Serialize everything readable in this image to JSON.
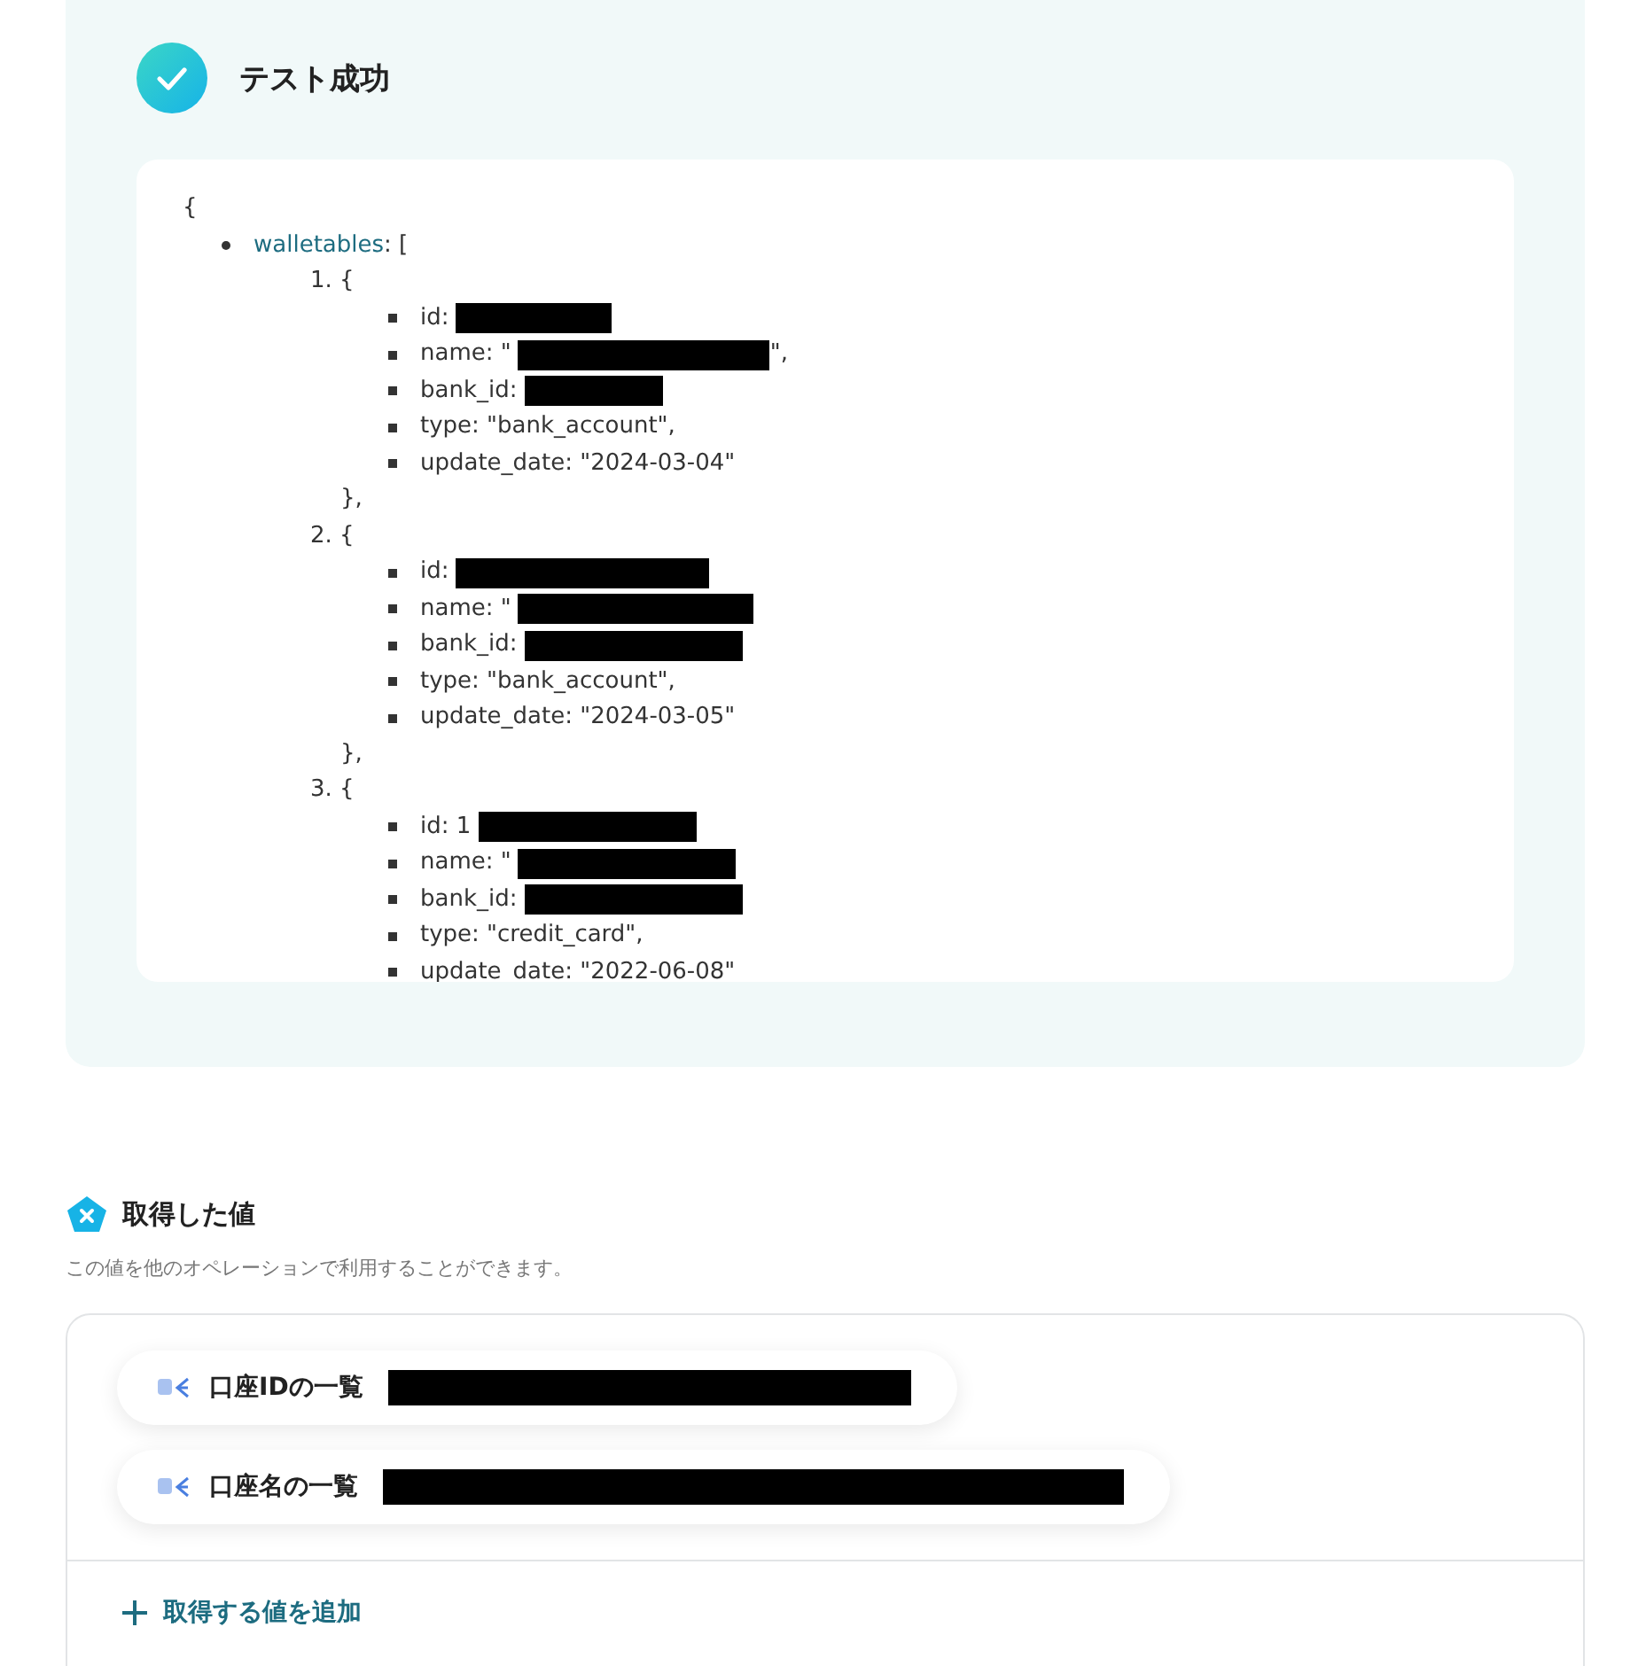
{
  "result": {
    "title": "テスト成功"
  },
  "output": {
    "open": "{",
    "key": "walletables",
    "key_suffix": ": [",
    "entries": [
      {
        "marker": "1. {",
        "close": "},",
        "fields": [
          {
            "text": "id:",
            "redacted": true
          },
          {
            "text": "name: \"",
            "redacted": true,
            "after": "\","
          },
          {
            "text": "bank_id:",
            "redacted": true
          },
          {
            "text": "type: \"bank_account\","
          },
          {
            "text": "update_date: \"2024-03-04\""
          }
        ]
      },
      {
        "marker": "2. {",
        "close": "},",
        "fields": [
          {
            "text": "id:",
            "redacted": true
          },
          {
            "text": "name: \"",
            "redacted": true
          },
          {
            "text": "bank_id:",
            "redacted": true
          },
          {
            "text": "type: \"bank_account\","
          },
          {
            "text": "update_date: \"2024-03-05\""
          }
        ]
      },
      {
        "marker": "3. {",
        "fields": [
          {
            "text": "id: 1",
            "redacted": true
          },
          {
            "text": "name: \"",
            "redacted": true
          },
          {
            "text": "bank_id:",
            "redacted": true
          },
          {
            "text": "type: \"credit_card\","
          },
          {
            "text": "update_date: \"2022-06-08\""
          }
        ]
      }
    ]
  },
  "values": {
    "title": "取得した値",
    "description": "この値を他のオペレーションで利用することができます。",
    "items": [
      {
        "label": "口座IDの一覧",
        "redacted": true
      },
      {
        "label": "口座名の一覧",
        "redacted": true
      }
    ],
    "add_label": "取得する値を追加"
  }
}
